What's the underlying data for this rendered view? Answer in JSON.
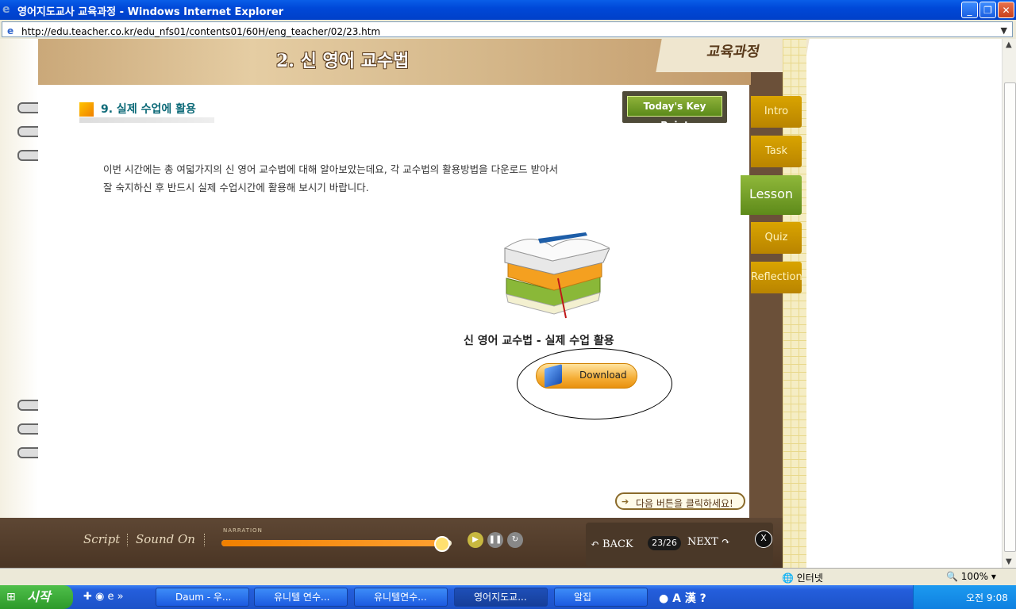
{
  "window": {
    "title": "영어지도교사 교육과정 - Windows Internet Explorer",
    "url": "http://edu.teacher.co.kr/edu_nfs01/contents01/60H/eng_teacher/02/23.htm"
  },
  "banner": {
    "title": "2. 신 영어 교수법",
    "corner_text": "교육과정"
  },
  "section": {
    "heading": "9. 실제 수업에 활용"
  },
  "key_point_label": "Today's Key Point",
  "intro": {
    "line1": "이번 시간에는 총 여덟가지의 신 영어 교수법에 대해 알아보았는데요, 각 교수법의 활용방법을 다운로드 받아서",
    "line2": "잘 숙지하신 후 반드시 실제 수업시간에 활용해 보시기 바랍니다."
  },
  "book_caption": "신 영어 교수법 - 실제 수업 활용",
  "download_label": "Download",
  "next_hint": "다음 버튼을 클릭하세요!",
  "tabs": [
    {
      "label": "Intro",
      "active": false
    },
    {
      "label": "Task",
      "active": false
    },
    {
      "label": "Lesson",
      "active": true
    },
    {
      "label": "Quiz",
      "active": false
    },
    {
      "label": "Reflection",
      "active": false
    }
  ],
  "controls": {
    "script_label": "Script",
    "sound_label": "Sound On",
    "narration_label": "NARRATION",
    "narration_progress": 0.96,
    "back_label": "BACK",
    "page_indicator": "23/26",
    "next_label": "NEXT",
    "close_label": "X"
  },
  "statusbar": {
    "zone": "인터넷",
    "zoom": "100%"
  },
  "taskbar": {
    "start_label": "시작",
    "buttons": [
      {
        "label": "Daum - 우...",
        "active": false
      },
      {
        "label": "유니텔 연수...",
        "active": false
      },
      {
        "label": "유니텔연수...",
        "active": false
      },
      {
        "label": "영어지도교...",
        "active": true
      },
      {
        "label": "알집",
        "active": false
      }
    ],
    "clock": "오전 9:08"
  },
  "colors": {
    "accent_green": "#6f9a22",
    "tab_gold": "#c99400",
    "frame_brown": "#6b5039",
    "xp_blue": "#245edc"
  }
}
